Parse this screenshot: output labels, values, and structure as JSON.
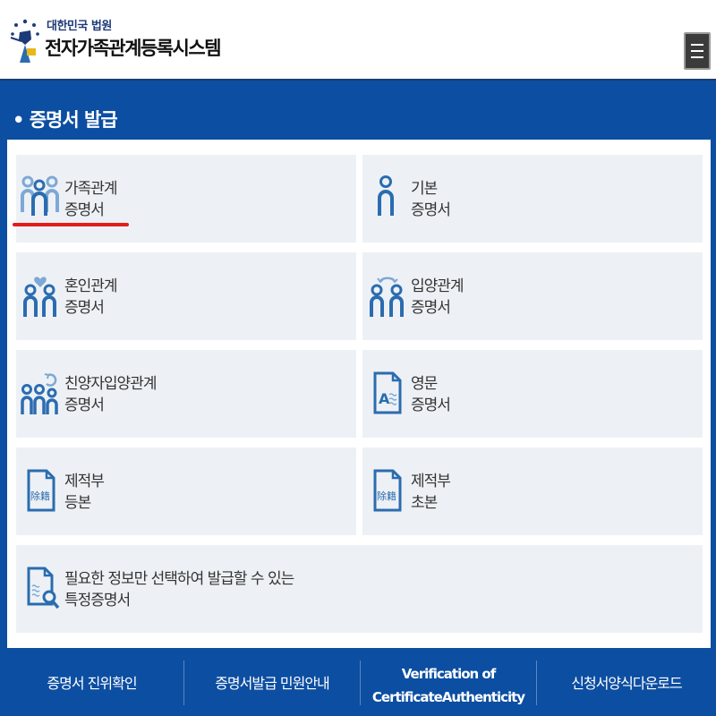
{
  "header": {
    "org_name": "대한민국 법원",
    "system_name": "전자가족관계등록시스템"
  },
  "section": {
    "title": "• 증명서 발급"
  },
  "cards": [
    {
      "line1": "가족관계",
      "line2": "증명서",
      "icon": "family-icon",
      "selected": true
    },
    {
      "line1": "기본",
      "line2": "증명서",
      "icon": "person-icon"
    },
    {
      "line1": "혼인관계",
      "line2": "증명서",
      "icon": "marriage-icon"
    },
    {
      "line1": "입양관계",
      "line2": "증명서",
      "icon": "adoption-icon"
    },
    {
      "line1": "친양자입양관계",
      "line2": "증명서",
      "icon": "full-adoption-icon"
    },
    {
      "line1": "영문",
      "line2": "증명서",
      "icon": "english-document-icon"
    },
    {
      "line1": "제적부",
      "line2": "등본",
      "icon": "removed-register-icon",
      "doc_text": "除籍"
    },
    {
      "line1": "제적부",
      "line2": "초본",
      "icon": "removed-register-icon",
      "doc_text": "除籍"
    },
    {
      "line1": "필요한 정보만 선택하여 발급할 수 있는",
      "line2": "특정증명서",
      "icon": "document-search-icon"
    }
  ],
  "footer": {
    "links": [
      {
        "label": "증명서 진위확인"
      },
      {
        "label": "증명서발급 민원안내"
      },
      {
        "label_line1": "Verification of",
        "label_line2": "CertificateAuthenticity"
      },
      {
        "label": "신청서양식다운로드"
      }
    ]
  },
  "colors": {
    "brand_blue": "#0c4ea1",
    "card_bg": "#edf1f5",
    "icon_blue": "#2b6cb0",
    "icon_light_blue": "#7ea8d6",
    "highlight_red": "#e31c1c"
  }
}
